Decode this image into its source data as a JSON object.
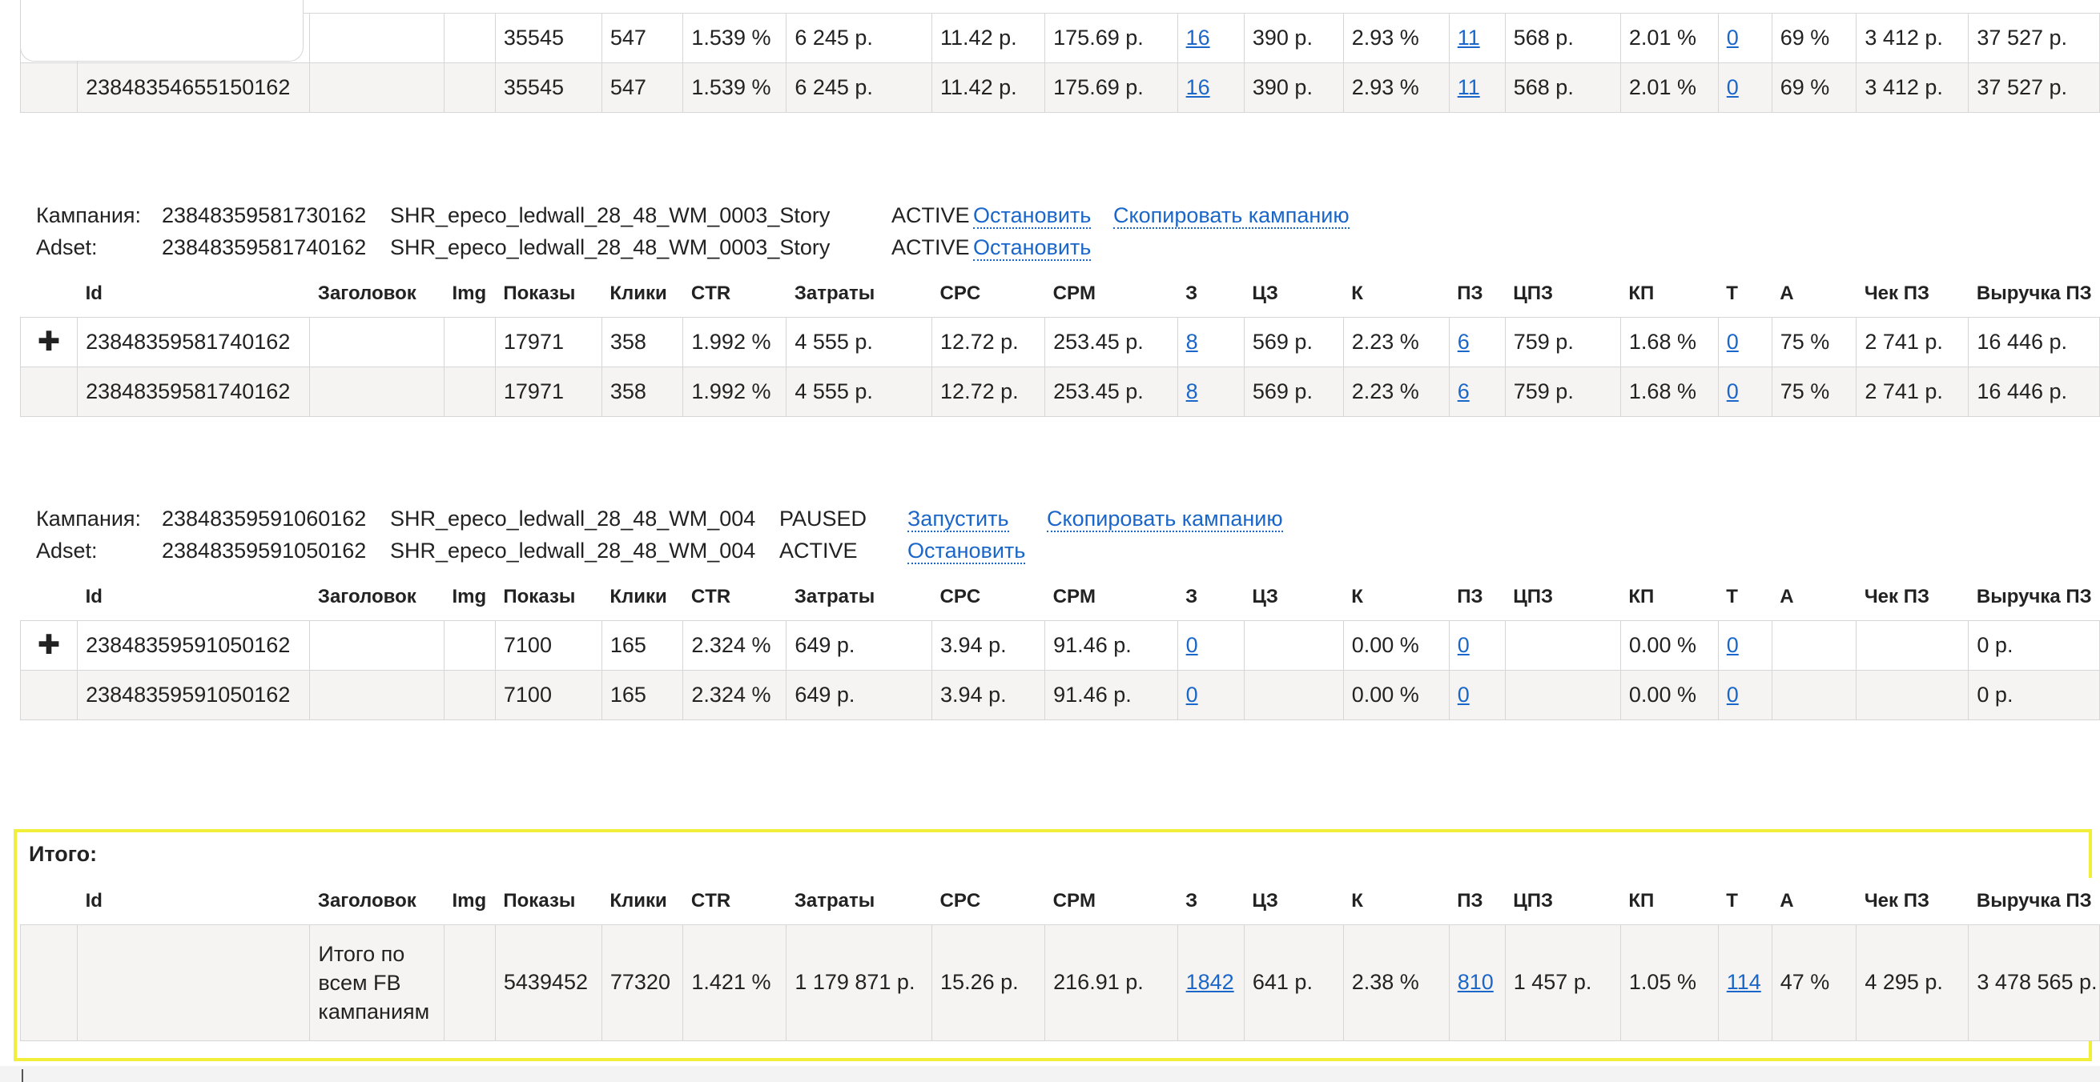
{
  "columns": [
    "",
    "Id",
    "Заголовок",
    "Img",
    "Показы",
    "Клики",
    "CTR",
    "Затраты",
    "CPC",
    "CPM",
    "З",
    "ЦЗ",
    "К",
    "ПЗ",
    "ЦПЗ",
    "КП",
    "Т",
    "А",
    "Чек ПЗ",
    "Выручка ПЗ"
  ],
  "block0": {
    "rows": [
      [
        "",
        "",
        "",
        "",
        "35545",
        "547",
        "1.539 %",
        "6 245 р.",
        "11.42 р.",
        "175.69 р.",
        "16",
        "390 р.",
        "2.93 %",
        "11",
        "568 р.",
        "2.01 %",
        "0",
        "69 %",
        "3 412 р.",
        "37 527 р."
      ],
      [
        "",
        "23848354655150162",
        "",
        "",
        "35545",
        "547",
        "1.539 %",
        "6 245 р.",
        "11.42 р.",
        "175.69 р.",
        "16",
        "390 р.",
        "2.93 %",
        "11",
        "568 р.",
        "2.01 %",
        "0",
        "69 %",
        "3 412 р.",
        "37 527 р."
      ]
    ]
  },
  "block1": {
    "campaign_label": "Кампания:",
    "campaign_id": "23848359581730162",
    "campaign_name": "SHR_epeco_ledwall_28_48_WM_0003_Story",
    "campaign_status": "ACTIVE",
    "campaign_action": "Остановить",
    "copy_action": "Скопировать кампанию",
    "adset_label": "Adset:",
    "adset_id": "23848359581740162",
    "adset_name": "SHR_epeco_ledwall_28_48_WM_0003_Story",
    "adset_status": "ACTIVE",
    "adset_action": "Остановить",
    "rows": [
      [
        "✚",
        "23848359581740162",
        "",
        "",
        "17971",
        "358",
        "1.992 %",
        "4 555 р.",
        "12.72 р.",
        "253.45 р.",
        "8",
        "569 р.",
        "2.23 %",
        "6",
        "759 р.",
        "1.68 %",
        "0",
        "75 %",
        "2 741 р.",
        "16 446 р."
      ],
      [
        "",
        "23848359581740162",
        "",
        "",
        "17971",
        "358",
        "1.992 %",
        "4 555 р.",
        "12.72 р.",
        "253.45 р.",
        "8",
        "569 р.",
        "2.23 %",
        "6",
        "759 р.",
        "1.68 %",
        "0",
        "75 %",
        "2 741 р.",
        "16 446 р."
      ]
    ]
  },
  "block2": {
    "campaign_label": "Кампания:",
    "campaign_id": "23848359591060162",
    "campaign_name": "SHR_epeco_ledwall_28_48_WM_004",
    "campaign_status": "PAUSED",
    "campaign_action": "Запустить",
    "copy_action": "Скопировать кампанию",
    "adset_label": "Adset:",
    "adset_id": "23848359591050162",
    "adset_name": "SHR_epeco_ledwall_28_48_WM_004",
    "adset_status": "ACTIVE",
    "adset_action": "Остановить",
    "rows": [
      [
        "✚",
        "23848359591050162",
        "",
        "",
        "7100",
        "165",
        "2.324 %",
        "649 р.",
        "3.94 р.",
        "91.46 р.",
        "0",
        "",
        "0.00 %",
        "0",
        "",
        "0.00 %",
        "0",
        "",
        "",
        "0 р."
      ],
      [
        "",
        "23848359591050162",
        "",
        "",
        "7100",
        "165",
        "2.324 %",
        "649 р.",
        "3.94 р.",
        "91.46 р.",
        "0",
        "",
        "0.00 %",
        "0",
        "",
        "0.00 %",
        "0",
        "",
        "",
        "0 р."
      ]
    ]
  },
  "totals": {
    "title": "Итого:",
    "row": [
      "",
      "",
      "Итого по всем FB кампаниям",
      "",
      "5439452",
      "77320",
      "1.421 %",
      "1 179 871 р.",
      "15.26 р.",
      "216.91 р.",
      "1842",
      "641 р.",
      "2.38 %",
      "810",
      "1 457 р.",
      "1.05 %",
      "114",
      "47 %",
      "4 295 р.",
      "3 478 565 р."
    ]
  },
  "colors": {
    "link": "#1a66c9",
    "highlight": "#f2ef3a",
    "alt_row": "#f5f4f2",
    "border": "#d6d6d6"
  }
}
